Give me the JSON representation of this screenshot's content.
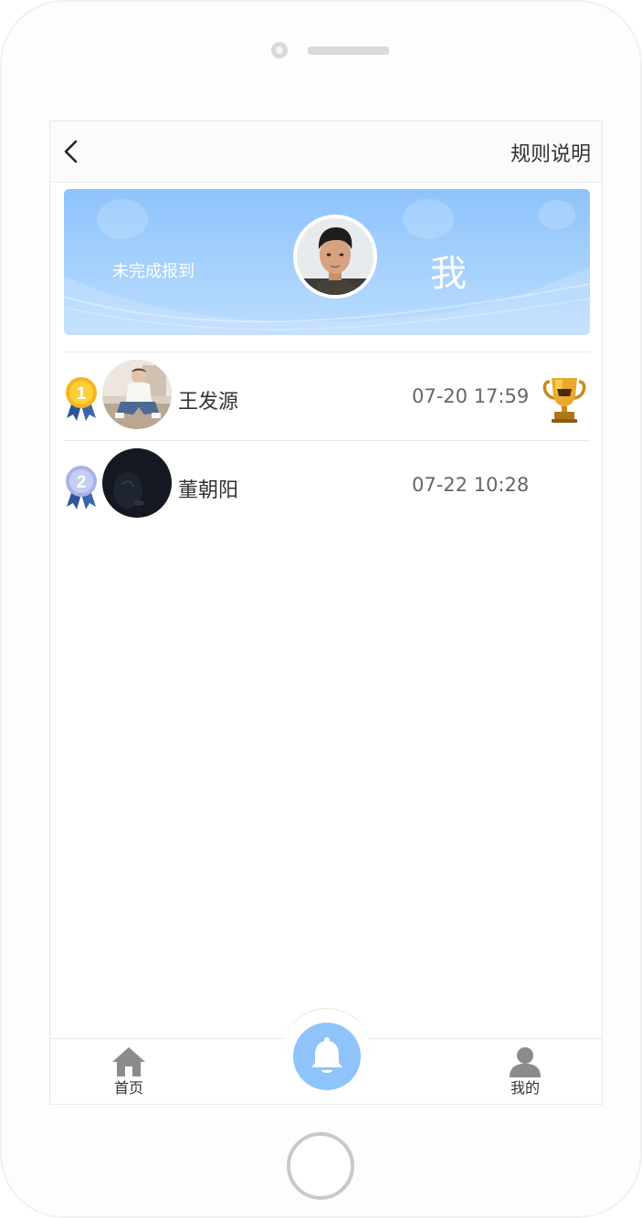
{
  "header": {
    "back_icon": "chevron-left-icon",
    "rules_label": "规则说明"
  },
  "banner": {
    "status_text": "未完成报到",
    "me_label": "我",
    "gradient": [
      "#8ec3fb",
      "#bcdcfd"
    ]
  },
  "ranking": [
    {
      "rank": "1",
      "name": "王发源",
      "time": "07-20 17:59",
      "medal": "gold-medal-icon",
      "trophy": "trophy-icon"
    },
    {
      "rank": "2",
      "name": "董朝阳",
      "time": "07-22 10:28",
      "medal": "silver-medal-icon"
    }
  ],
  "tabbar": {
    "home_label": "首页",
    "mine_label": "我的",
    "center_icon": "bell-icon",
    "accent": "#8fc3fb"
  }
}
